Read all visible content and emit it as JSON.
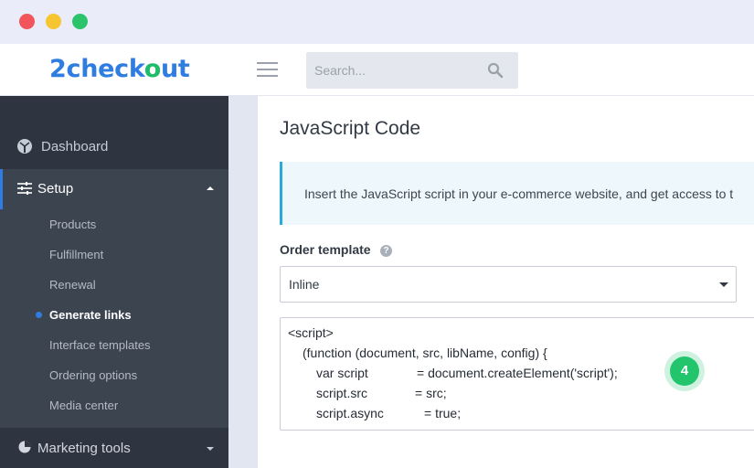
{
  "window": {
    "controls": [
      "close",
      "minimize",
      "maximize"
    ]
  },
  "header": {
    "logo_part1": "2check",
    "logo_part2": "o",
    "logo_part3": "ut",
    "search_placeholder": "Search...",
    "icons": [
      "menu-icon",
      "search-icon"
    ]
  },
  "sidebar": {
    "dashboard": "Dashboard",
    "setup": "Setup",
    "setup_items": [
      "Products",
      "Fulfillment",
      "Renewal",
      "Generate links",
      "Interface templates",
      "Ordering options",
      "Media center"
    ],
    "active_item": "Generate links",
    "marketing": "Marketing tools"
  },
  "main": {
    "title": "JavaScript Code",
    "info_text": "Insert the JavaScript script in your e-commerce website, and get access to t",
    "order_template_label": "Order template",
    "help_glyph": "?",
    "order_template_value": "Inline",
    "code_lines": [
      "<script>",
      "(function (document, src, libName, config) {",
      "var script",
      "= document.createElement('script');",
      "script.src",
      "= src;",
      "script.async",
      "= true;"
    ],
    "step_badge": "4"
  },
  "colors": {
    "accent": "#2f7de1",
    "brand_green": "#1fbc6c",
    "sidebar_bg": "#3c4450",
    "info_border": "#2aa9dc"
  }
}
